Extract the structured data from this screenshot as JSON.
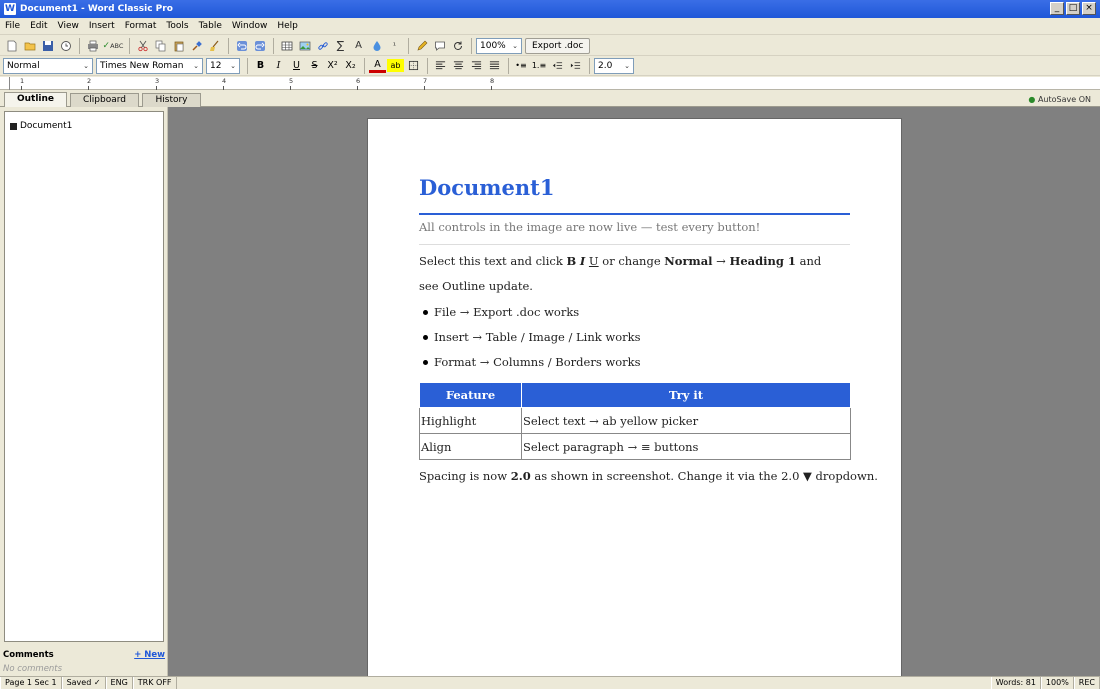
{
  "window": {
    "app_icon": "W",
    "title": "Document1 - Word Classic Pro",
    "btn_minimize": "_",
    "btn_maximize": "□",
    "btn_close": "×"
  },
  "menu": [
    "File",
    "Edit",
    "View",
    "Insert",
    "Format",
    "Tools",
    "Table",
    "Window",
    "Help"
  ],
  "toolbar1": {
    "zoom": "100%",
    "export_label": "Export .doc",
    "abc_label": "ABC",
    "sum_glyph": "∑",
    "font_a": "A",
    "superscript_1": "¹"
  },
  "toolbar2": {
    "style": "Normal",
    "font": "Times New Roman",
    "size": "12",
    "bold": "B",
    "italic": "I",
    "underline": "U",
    "strike": "S",
    "superscript": "X²",
    "subscript": "X₂",
    "font_color": "A",
    "highlight": "ab",
    "bullets": "•≡",
    "numbering": "1.≡",
    "line_spacing": "2.0"
  },
  "ruler": {
    "numbers": [
      "1",
      "2",
      "3",
      "4",
      "5",
      "6",
      "7",
      "8"
    ]
  },
  "tabs": [
    "Outline",
    "Clipboard",
    "History"
  ],
  "autosave": "AutoSave ON",
  "outline": {
    "item": "Document1"
  },
  "comments": {
    "header": "Comments",
    "new_label": "+ New",
    "empty": "No comments"
  },
  "document": {
    "title": "Document1",
    "subtitle": "All controls in the image are now live — test every button!",
    "para_pre": "Select this text and click ",
    "para_b": "B",
    "para_i": "I",
    "para_u": "U",
    "para_mid": " or change ",
    "para_normal": "Normal",
    "para_arrow": " → ",
    "para_h1": "Heading 1",
    "para_post": " and see Outline update.",
    "bullets": [
      "File → Export .doc works",
      "Insert → Table / Image / Link works",
      "Format → Columns / Borders works"
    ],
    "table": {
      "headers": [
        "Feature",
        "Try it"
      ],
      "rows": [
        [
          "Highlight",
          "Select text → ab yellow picker"
        ],
        [
          "Align",
          "Select paragraph → ≡ buttons"
        ]
      ]
    },
    "spacing_pre": "Spacing is now ",
    "spacing_val": "2.0",
    "spacing_post": " as shown in screenshot. Change it via the 2.0 ▼ dropdown."
  },
  "status": {
    "page": "Page 1 Sec 1",
    "saved": "Saved ✓",
    "lang": "ENG",
    "track": "TRK OFF",
    "words": "Words: 81",
    "zoom": "100%",
    "rec": "REC"
  },
  "colors": {
    "accent": "#2a5fd6",
    "titlebar": "#1f57d8",
    "workarea": "#808080",
    "highlight_yellow": "#ffff00",
    "font_color_red": "#cc0000"
  }
}
